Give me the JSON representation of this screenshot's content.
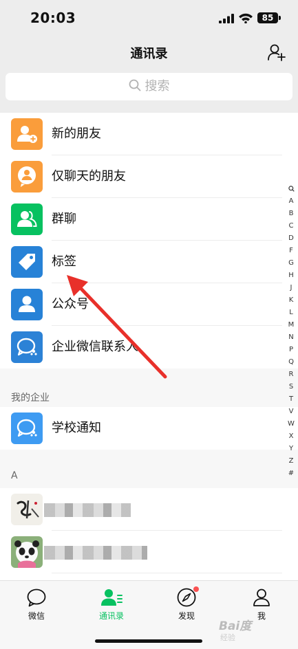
{
  "status_bar": {
    "time": "20:03",
    "battery": "85"
  },
  "header": {
    "title": "通讯录"
  },
  "search": {
    "placeholder": "搜索"
  },
  "entries": [
    {
      "label": "新的朋友",
      "color": "#fa9d3b"
    },
    {
      "label": "仅聊天的朋友",
      "color": "#fa9d3b"
    },
    {
      "label": "群聊",
      "color": "#07c160"
    },
    {
      "label": "标签",
      "color": "#2782d7"
    },
    {
      "label": "公众号",
      "color": "#2782d7"
    },
    {
      "label": "企业微信联系人",
      "color": "#2c82d6"
    }
  ],
  "enterprise": {
    "header": "我的企业",
    "item": {
      "label": "学校通知",
      "color": "#3e9bf2"
    }
  },
  "contacts": {
    "header": "A"
  },
  "index_letters": [
    "Q",
    "A",
    "B",
    "C",
    "D",
    "F",
    "G",
    "H",
    "J",
    "K",
    "L",
    "M",
    "N",
    "P",
    "Q",
    "R",
    "S",
    "T",
    "V",
    "W",
    "X",
    "Y",
    "Z",
    "#"
  ],
  "tabs": [
    {
      "label": "微信",
      "icon": "chat-bubble-icon"
    },
    {
      "label": "通讯录",
      "icon": "contacts-icon",
      "active": true
    },
    {
      "label": "发现",
      "icon": "compass-icon"
    },
    {
      "label": "我",
      "icon": "person-icon"
    }
  ],
  "colors": {
    "accent": "#07c160",
    "arrow": "#e8302a",
    "badge": "#fa5151"
  },
  "watermark": {
    "brand": "Bai度",
    "sub": "经验"
  }
}
